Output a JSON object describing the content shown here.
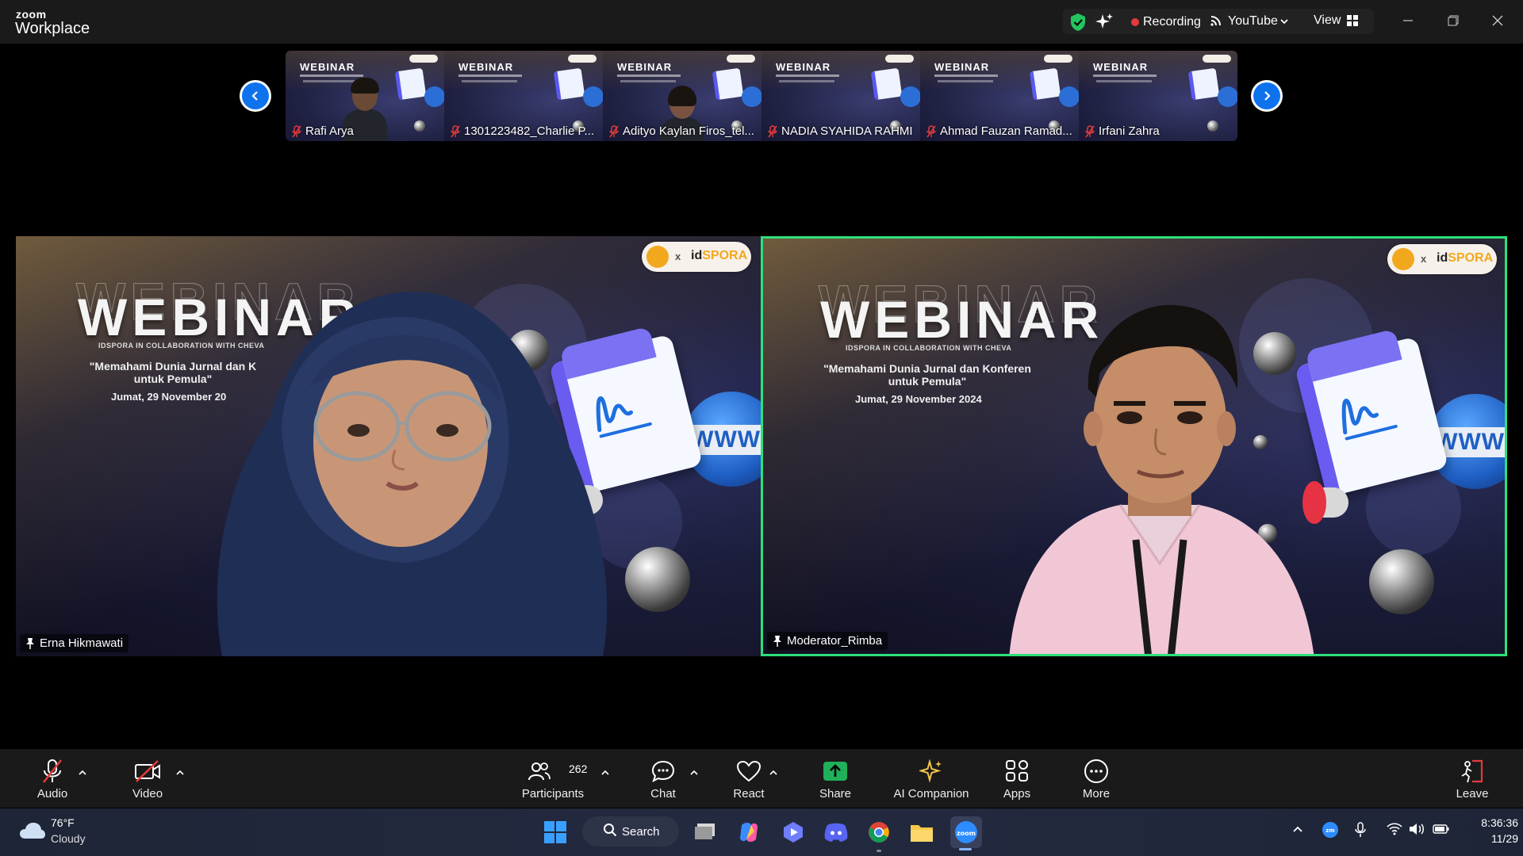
{
  "app": {
    "brand_top": "zoom",
    "brand_main": "Workplace"
  },
  "status": {
    "recording": "Recording",
    "stream": "YouTube",
    "view": "View"
  },
  "strip": {
    "thumb_title": "WEBINAR",
    "participants": [
      {
        "name": "Rafi Arya"
      },
      {
        "name": "1301223482_Charlie P..."
      },
      {
        "name": "Adityo Kaylan Firos_tel..."
      },
      {
        "name": "NADIA SYAHIDA RAHMI"
      },
      {
        "name": "Ahmad Fauzan Ramad..."
      },
      {
        "name": "Irfani Zahra"
      }
    ]
  },
  "tiles": {
    "left": {
      "name": "Erna Hikmawati",
      "webinar": "WEBINAR",
      "collab": "IDSPORA IN COLLABORATION WITH CHEVA",
      "quote_line1": "\"Memahami Dunia Jurnal dan K",
      "quote_line2": "untuk Pemula\"",
      "date": "Jumat, 29 November 20",
      "logo_prefix": "id",
      "logo_accent": "SPORA"
    },
    "right": {
      "name": "Moderator_Rimba",
      "webinar": "WEBINAR",
      "collab": "IDSPORA IN COLLABORATION WITH CHEVA",
      "quote_line1": "\"Memahami Dunia Jurnal dan Konferen",
      "quote_line2": "untuk Pemula\"",
      "date": "Jumat, 29 November 2024",
      "logo_prefix": "id",
      "logo_accent": "SPORA",
      "globe_text": "WWW."
    },
    "left_globe_text": "WWW."
  },
  "toolbar": {
    "audio": "Audio",
    "video": "Video",
    "participants": "Participants",
    "participants_count": "262",
    "chat": "Chat",
    "react": "React",
    "share": "Share",
    "ai_companion": "AI Companion",
    "apps": "Apps",
    "more": "More",
    "leave": "Leave"
  },
  "taskbar": {
    "weather_temp": "76°F",
    "weather_cond": "Cloudy",
    "search": "Search",
    "time": "8:36:36",
    "date": "11/29"
  },
  "colors": {
    "active_speaker_border": "#2ee07a",
    "zoom_blue": "#0e72ed",
    "recording_red": "#e23b3b",
    "share_green": "#1fb05a",
    "ai_yellow": "#f4c54a"
  },
  "icons": [
    "shield-icon",
    "sparkle-icon",
    "record-dot-icon",
    "stream-icon",
    "chevron-down-icon",
    "grid-icon",
    "minimize-icon",
    "restore-icon",
    "close-icon",
    "chevron-left-icon",
    "chevron-right-icon",
    "mic-off-icon",
    "pin-icon",
    "video-off-icon",
    "people-icon",
    "chat-icon",
    "heart-icon",
    "share-arrow-icon",
    "apps-icon",
    "more-icon",
    "leave-icon",
    "cloud-icon",
    "windows-icon",
    "search-icon"
  ]
}
